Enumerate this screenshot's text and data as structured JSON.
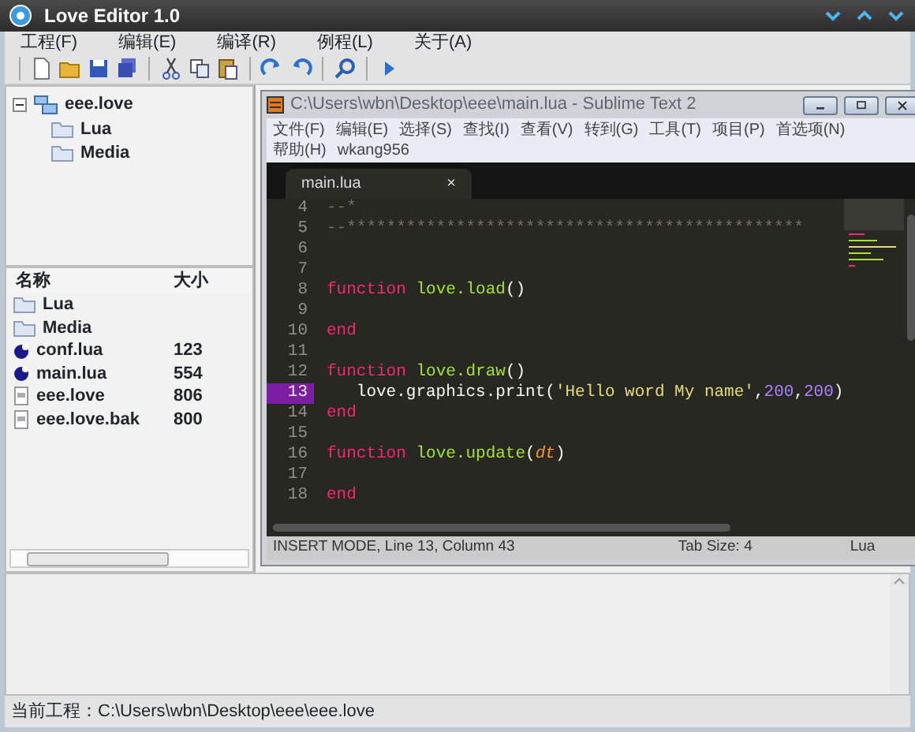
{
  "window": {
    "title": "Love Editor 1.0"
  },
  "menu": [
    "工程(F)",
    "编辑(E)",
    "编译(R)",
    "例程(L)",
    "关于(A)"
  ],
  "tree": {
    "label": "eee.love",
    "expanded": true,
    "children": [
      {
        "label": "Lua"
      },
      {
        "label": "Media"
      }
    ]
  },
  "files": {
    "columns": [
      "名称",
      "大小"
    ],
    "rows": [
      {
        "kind": "folder",
        "name": "Lua"
      },
      {
        "kind": "folder",
        "name": "Media"
      },
      {
        "kind": "lua",
        "name": "conf.lua",
        "size": "123"
      },
      {
        "kind": "lua",
        "name": "main.lua",
        "size": "554"
      },
      {
        "kind": "file",
        "name": "eee.love",
        "size": "806"
      },
      {
        "kind": "file",
        "name": "eee.love.bak",
        "size": "800"
      }
    ]
  },
  "editor": {
    "title": "C:\\Users\\wbn\\Desktop\\eee\\main.lua - Sublime Text 2",
    "menu_rows": [
      [
        "文件(F)",
        "编辑(E)",
        "选择(S)",
        "查找(I)",
        "查看(V)",
        "转到(G)",
        "工具(T)",
        "项目(P)",
        "首选项(N)"
      ],
      [
        "帮助(H)",
        "wkang956"
      ]
    ],
    "tabs": [
      {
        "label": "main.lua",
        "close": "×",
        "selected": true
      }
    ],
    "lines": [
      {
        "number": "4",
        "current": false,
        "tokens": [
          {
            "kind": "comment",
            "text": "--*"
          }
        ]
      },
      {
        "number": "5",
        "current": false,
        "tokens": [
          {
            "kind": "comment",
            "text": "--**********************************************"
          }
        ]
      },
      {
        "number": "6",
        "current": false
      },
      {
        "number": "7",
        "current": false
      },
      {
        "number": "8",
        "current": false,
        "tokens": [
          {
            "kind": "keyword",
            "text": "function"
          },
          {
            "kind": "func",
            "text": " love.load"
          },
          {
            "kind": "plain",
            "text": "()"
          }
        ]
      },
      {
        "number": "9",
        "current": false
      },
      {
        "number": "10",
        "current": false,
        "tokens": [
          {
            "kind": "keyword",
            "text": "end"
          }
        ]
      },
      {
        "number": "11",
        "current": false
      },
      {
        "number": "12",
        "current": false,
        "tokens": [
          {
            "kind": "keyword",
            "text": "function"
          },
          {
            "kind": "func",
            "text": " love.draw"
          },
          {
            "kind": "plain",
            "text": "()"
          }
        ]
      },
      {
        "number": "13",
        "current": true,
        "tokens": [
          {
            "kind": "plain",
            "text": "   love.graphics.print("
          },
          {
            "kind": "string",
            "text": "'Hello word My name'"
          },
          {
            "kind": "plain",
            "text": ","
          },
          {
            "kind": "number",
            "text": "200"
          },
          {
            "kind": "plain",
            "text": ","
          },
          {
            "kind": "number",
            "text": "200"
          },
          {
            "kind": "plain",
            "text": ")"
          }
        ]
      },
      {
        "number": "14",
        "current": false,
        "tokens": [
          {
            "kind": "keyword",
            "text": "end"
          }
        ]
      },
      {
        "number": "15",
        "current": false
      },
      {
        "number": "16",
        "current": false,
        "tokens": [
          {
            "kind": "keyword",
            "text": "function"
          },
          {
            "kind": "func",
            "text": " love.update"
          },
          {
            "kind": "plain",
            "text": "("
          },
          {
            "kind": "param",
            "text": "dt"
          },
          {
            "kind": "plain",
            "text": ")"
          }
        ]
      },
      {
        "number": "17",
        "current": false
      },
      {
        "number": "18",
        "current": false,
        "tokens": [
          {
            "kind": "keyword",
            "text": "end"
          }
        ]
      }
    ],
    "status": {
      "mode": "INSERT MODE, Line 13, Column 43",
      "tab_size": "Tab Size: 4",
      "syntax": "Lua"
    }
  },
  "status_bar": "当前工程：C:\\Users\\wbn\\Desktop\\eee\\eee.love"
}
